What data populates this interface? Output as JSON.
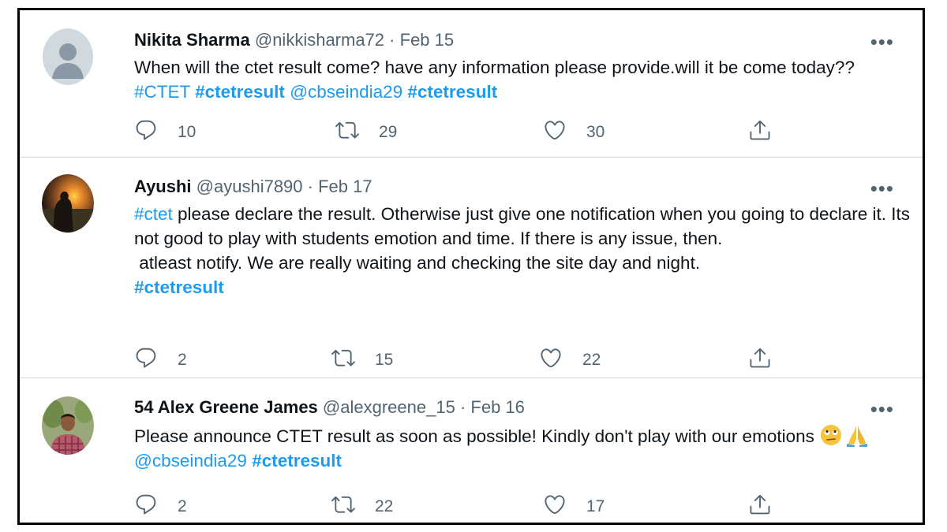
{
  "tweets": [
    {
      "name": "Nikita Sharma",
      "handle": "@nikkisharma72",
      "dot": "·",
      "date": "Feb 15",
      "more": "•••",
      "text_plain": "When will the ctet result come? have any information please provide.will it be come today?? ",
      "tag1": "#CTET",
      "tag2": "#ctetresult",
      "mention": "@cbseindia29",
      "tag3": "#ctetresult",
      "replies": "10",
      "retweets": "29",
      "likes": "30"
    },
    {
      "name": "Ayushi",
      "handle": "@ayushi7890",
      "dot": "·",
      "date": "Feb 17",
      "more": "•••",
      "tag_start": "#ctet",
      "line1": " please declare the result. Otherwise just give one notification when you going to declare it. Its not good to play with students emotion and time. If there is any issue, then.",
      "line2": " atleast notify. We are really waiting and checking the site day and night.",
      "tag_end": "#ctetresult",
      "replies": "2",
      "retweets": "15",
      "likes": "22"
    },
    {
      "name": "54 Alex Greene James",
      "handle": "@alexgreene_15",
      "dot": "·",
      "date": "Feb 16",
      "more": "•••",
      "text_plain": "Please announce CTET result as soon as possible! Kindly don't play with our emotions ",
      "mention": "@cbseindia29",
      "tag": "#ctetresult",
      "replies": "2",
      "retweets": "22",
      "likes": "17"
    }
  ],
  "icons": {
    "reply": "reply-icon",
    "retweet": "retweet-icon",
    "like": "heart-icon",
    "share": "share-icon"
  },
  "colors": {
    "link": "#1d9bf0",
    "muted": "#536471",
    "text": "#0f1419",
    "divider": "#cfd9de"
  }
}
